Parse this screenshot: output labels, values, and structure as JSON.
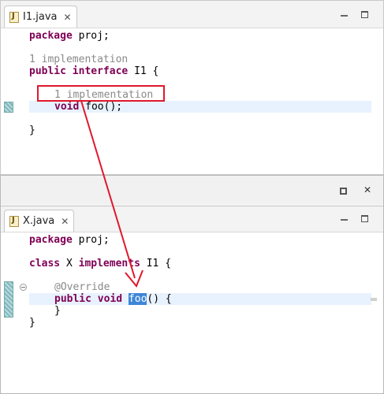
{
  "top_editor": {
    "tab_label": "I1.java",
    "lines": {
      "package_kw": "package",
      "package_rest": " proj;",
      "lens1": "1 implementation",
      "public_kw": "public",
      "interface_kw": "interface",
      "interface_rest": " I1 {",
      "lens2": "1 implementation",
      "void_kw": "void",
      "method_rest": " foo();",
      "closing": "}"
    }
  },
  "bottom_editor": {
    "tab_label": "X.java",
    "lines": {
      "package_kw": "package",
      "package_rest": " proj;",
      "class_kw": "class",
      "class_name": " X ",
      "implements_kw": "implements",
      "implements_rest": " I1 {",
      "annotation": "@Override",
      "public_kw": "public",
      "void_kw": "void",
      "method_name": "foo",
      "method_rest": "() {",
      "inner_close": "}",
      "outer_close": "}"
    }
  },
  "colors": {
    "keyword": "#7f0055",
    "code_lens": "#8a8a8a",
    "current_line": "#e8f2fe",
    "selection": "#3d86d8",
    "annotation_arrow": "#e0182c"
  },
  "icons": {
    "file": "java-file-icon",
    "close": "close-icon",
    "minimize": "minimize-icon",
    "maximize": "maximize-icon",
    "restore": "restore-icon",
    "fold": "fold-collapse-icon"
  }
}
